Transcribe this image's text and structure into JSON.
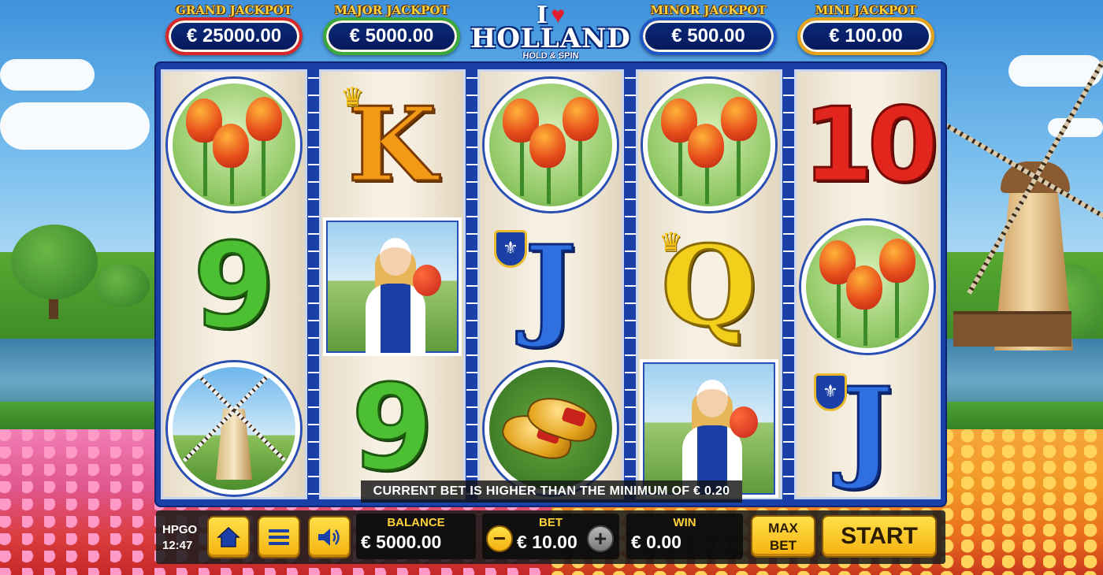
{
  "logo": {
    "top": "I",
    "main": "HOLLAND",
    "sub": "HOLD & SPIN"
  },
  "jackpots": [
    {
      "title": "GRAND JACKPOT",
      "value": "€ 25000.00"
    },
    {
      "title": "MAJOR JACKPOT",
      "value": "€ 5000.00"
    },
    {
      "title": "MINOR JACKPOT",
      "value": "€ 500.00"
    },
    {
      "title": "MINI JACKPOT",
      "value": "€ 100.00"
    }
  ],
  "reels": [
    [
      "tulips",
      "9",
      "windmill"
    ],
    [
      "K",
      "dutch-girl",
      "9"
    ],
    [
      "tulips",
      "J",
      "clogs"
    ],
    [
      "tulips",
      "Q",
      "dutch-girl"
    ],
    [
      "10",
      "tulips",
      "J"
    ]
  ],
  "symbols": {
    "k": "K",
    "q": "Q",
    "j": "J",
    "nine": "9",
    "ten": "10"
  },
  "notice": "CURRENT BET IS HIGHER THAN THE MINIMUM OF € 0.20",
  "controls": {
    "brand": "HPGO",
    "clock": "12:47",
    "balance_label": "BALANCE",
    "balance_value": "€ 5000.00",
    "bet_label": "BET",
    "bet_value": "€ 10.00",
    "win_label": "WIN",
    "win_value": "€ 0.00",
    "minus": "−",
    "plus": "+",
    "max_bet_line1": "MAX",
    "max_bet_line2": "BET",
    "start": "START"
  },
  "icons": {
    "home": "home-icon",
    "menu": "menu-icon",
    "sound": "speaker-icon"
  }
}
